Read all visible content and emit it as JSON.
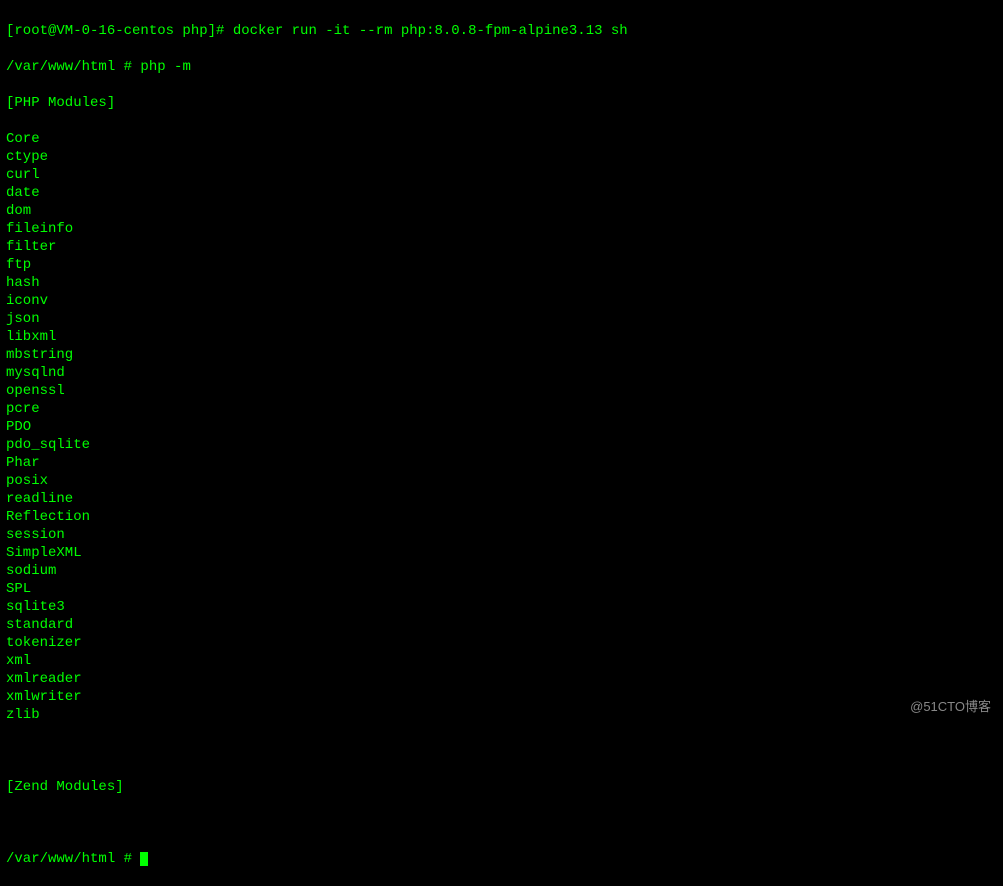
{
  "terminal": {
    "line1_prompt": "[root@VM-0-16-centos php]#",
    "line1_command": " docker run -it --rm php:8.0.8-fpm-alpine3.13 sh",
    "line2_prompt": "/var/www/html #",
    "line2_command": " php -m",
    "php_modules_header": "[PHP Modules]",
    "modules": [
      "Core",
      "ctype",
      "curl",
      "date",
      "dom",
      "fileinfo",
      "filter",
      "ftp",
      "hash",
      "iconv",
      "json",
      "libxml",
      "mbstring",
      "mysqlnd",
      "openssl",
      "pcre",
      "PDO",
      "pdo_sqlite",
      "Phar",
      "posix",
      "readline",
      "Reflection",
      "session",
      "SimpleXML",
      "sodium",
      "SPL",
      "sqlite3",
      "standard",
      "tokenizer",
      "xml",
      "xmlreader",
      "xmlwriter",
      "zlib"
    ],
    "zend_modules_header": "[Zend Modules]",
    "final_prompt": "/var/www/html # "
  },
  "watermark": "@51CTO博客"
}
